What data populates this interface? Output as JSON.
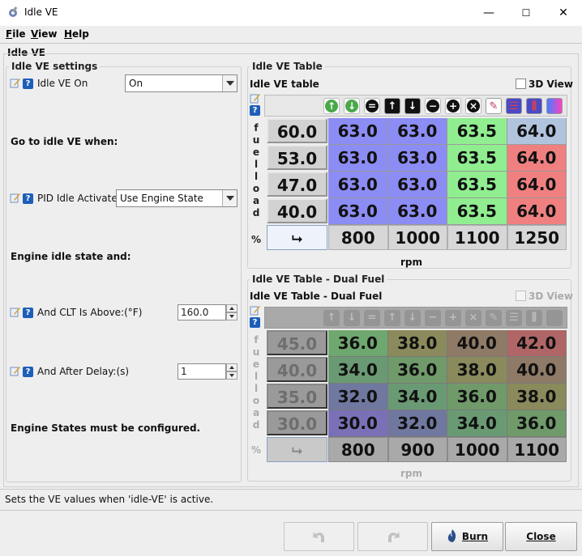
{
  "window": {
    "title": "Idle VE",
    "icon": "wrench-gear-icon",
    "controls": [
      "—",
      "☐",
      "✕"
    ]
  },
  "menu": [
    {
      "label": "File",
      "mnemonic": "F",
      "rest": "ile"
    },
    {
      "label": "View",
      "mnemonic": "V",
      "rest": "iew"
    },
    {
      "label": "Help",
      "mnemonic": "H",
      "rest": "elp"
    }
  ],
  "panel_title": "Idle VE",
  "settings": {
    "title": "Idle VE settings",
    "idle_ve_on": {
      "label": "Idle VE On",
      "value": "On"
    },
    "go_to_label": "Go to idle VE when:",
    "pid_idle": {
      "label": "PID Idle Activates",
      "value": "Use Engine State"
    },
    "engine_idle_label": "Engine idle state and:",
    "clt": {
      "label": "And CLT Is Above:(°F)",
      "value": "160.0"
    },
    "delay": {
      "label": "And After Delay:(s)",
      "value": "1"
    },
    "footer_label": "Engine States must be configured."
  },
  "table1": {
    "group_title": "Idle VE Table",
    "title": "Idle VE table",
    "view3d": "3D View",
    "y_axis": [
      "f",
      "u",
      "e",
      "l",
      "l",
      "o",
      "a",
      "d"
    ],
    "y_unit": "%",
    "x_label": "rpm",
    "row_headers": [
      "60.0",
      "53.0",
      "47.0",
      "40.0"
    ],
    "col_headers": [
      "800",
      "1000",
      "1100",
      "1250"
    ],
    "cells": [
      [
        "63.0",
        "63.0",
        "63.5",
        "64.0"
      ],
      [
        "63.0",
        "63.0",
        "63.5",
        "64.0"
      ],
      [
        "63.0",
        "63.0",
        "63.5",
        "64.0"
      ],
      [
        "63.0",
        "63.0",
        "63.5",
        "64.0"
      ]
    ],
    "cell_colors": [
      [
        "#8c8cf5",
        "#8c8cf5",
        "#90ee90",
        "#b0c4de"
      ],
      [
        "#8c8cf5",
        "#8c8cf5",
        "#90ee90",
        "#f08080"
      ],
      [
        "#8c8cf5",
        "#8c8cf5",
        "#90ee90",
        "#f08080"
      ],
      [
        "#8c8cf5",
        "#8c8cf5",
        "#90ee90",
        "#f08080"
      ]
    ]
  },
  "table2": {
    "group_title": "Idle VE Table - Dual Fuel",
    "title": "Idle VE Table - Dual Fuel",
    "view3d": "3D View",
    "y_axis": [
      "f",
      "u",
      "e",
      "l",
      "l",
      "o",
      "a",
      "d"
    ],
    "y_unit": "%",
    "x_label": "rpm",
    "row_headers": [
      "45.0",
      "40.0",
      "35.0",
      "30.0"
    ],
    "col_headers": [
      "800",
      "900",
      "1000",
      "1100"
    ],
    "cells": [
      [
        "36.0",
        "38.0",
        "40.0",
        "42.0"
      ],
      [
        "34.0",
        "36.0",
        "38.0",
        "40.0"
      ],
      [
        "32.0",
        "34.0",
        "36.0",
        "38.0"
      ],
      [
        "30.0",
        "32.0",
        "34.0",
        "36.0"
      ]
    ],
    "cell_colors": [
      [
        "#6fa86f",
        "#8a8a5c",
        "#8e7a66",
        "#b06666"
      ],
      [
        "#6a9a74",
        "#709a6a",
        "#8a8a5c",
        "#8e7a66"
      ],
      [
        "#7078a0",
        "#6a9a74",
        "#709a6a",
        "#8a8a5c"
      ],
      [
        "#7a70b8",
        "#7078a0",
        "#6a9a74",
        "#709a6a"
      ]
    ]
  },
  "toolbar_icons": [
    "up-arrow-circle-icon",
    "down-arrow-circle-icon",
    "equals-icon",
    "up-arrow-icon",
    "down-arrow-icon",
    "minus-icon",
    "plus-icon",
    "multiply-icon",
    "pencil-icon",
    "horizontal-bars-icon",
    "vertical-bars-icon",
    "gradient-icon"
  ],
  "status": "Sets the VE values when 'idle-VE' is active.",
  "buttons": {
    "undo": "undo-icon",
    "redo": "redo-icon",
    "burn": "Burn",
    "close": "Close"
  },
  "colors": {
    "blue_cell": "#8c8cf5",
    "green_cell": "#90ee90",
    "red_cell": "#f08080"
  }
}
